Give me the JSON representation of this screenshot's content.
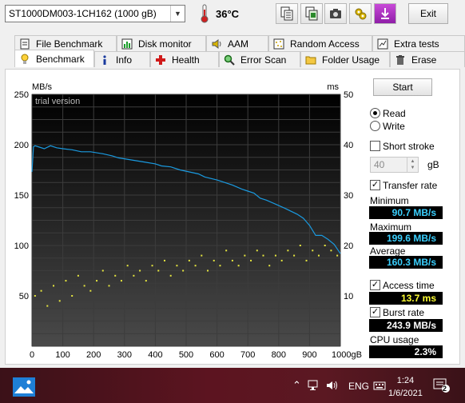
{
  "toolbar": {
    "drive": "ST1000DM003-1CH162 (1000 gB)",
    "temperature": "36°C",
    "exit_label": "Exit",
    "icons": [
      "copy-text-icon",
      "copy-screenshot-icon",
      "camera-icon",
      "options-icon",
      "download-icon"
    ]
  },
  "tabs_top": [
    {
      "label": "File Benchmark",
      "icon": "file-icon"
    },
    {
      "label": "Disk monitor",
      "icon": "monitor-icon"
    },
    {
      "label": "AAM",
      "icon": "speaker-icon"
    },
    {
      "label": "Random Access",
      "icon": "random-icon"
    },
    {
      "label": "Extra tests",
      "icon": "extra-icon"
    }
  ],
  "tabs_bottom": [
    {
      "label": "Benchmark",
      "icon": "lightbulb-icon",
      "active": true
    },
    {
      "label": "Info",
      "icon": "info-icon"
    },
    {
      "label": "Health",
      "icon": "health-cross-icon"
    },
    {
      "label": "Error Scan",
      "icon": "magnifier-icon"
    },
    {
      "label": "Folder Usage",
      "icon": "folder-icon"
    },
    {
      "label": "Erase",
      "icon": "trash-icon"
    }
  ],
  "chart_data": {
    "type": "line",
    "annotation": "trial version",
    "y_left_unit": "MB/s",
    "y_right_unit": "ms",
    "x_unit": "gB",
    "x_ticks": [
      0,
      100,
      200,
      300,
      400,
      500,
      600,
      700,
      800,
      900,
      1000
    ],
    "y_left_ticks": [
      50,
      100,
      150,
      200,
      250
    ],
    "y_right_ticks": [
      10,
      20,
      30,
      40,
      50
    ],
    "xlim": [
      0,
      1000
    ],
    "ylim_left": [
      0,
      250
    ],
    "ylim_right": [
      0,
      50
    ],
    "grid": true,
    "series": [
      {
        "name": "Transfer rate",
        "color": "#1a9ae0",
        "axis": "left",
        "x": [
          0,
          5,
          10,
          20,
          40,
          60,
          80,
          100,
          130,
          160,
          190,
          230,
          260,
          280,
          300,
          320,
          360,
          400,
          420,
          450,
          480,
          510,
          540,
          560,
          600,
          620,
          650,
          680,
          700,
          720,
          740,
          760,
          790,
          820,
          840,
          860,
          880,
          900,
          920,
          940,
          960,
          980,
          1000
        ],
        "y": [
          173,
          198,
          199,
          198,
          196,
          199,
          197,
          196,
          195,
          193,
          193,
          191,
          189,
          187,
          186,
          185,
          183,
          181,
          179,
          178,
          175,
          173,
          171,
          168,
          165,
          163,
          160,
          156,
          154,
          152,
          147,
          145,
          141,
          137,
          134,
          131,
          127,
          120,
          110,
          110,
          106,
          101,
          92
        ]
      },
      {
        "name": "Access time",
        "color": "#e6e640",
        "axis": "right",
        "type": "scatter",
        "x": [
          10,
          30,
          50,
          70,
          90,
          110,
          130,
          150,
          170,
          190,
          210,
          230,
          250,
          270,
          290,
          310,
          330,
          350,
          370,
          390,
          410,
          430,
          450,
          470,
          490,
          510,
          530,
          550,
          570,
          590,
          610,
          630,
          650,
          670,
          690,
          710,
          730,
          750,
          770,
          790,
          810,
          830,
          850,
          870,
          890,
          910,
          930,
          950,
          970,
          990
        ],
        "y": [
          10,
          11,
          8,
          12,
          9,
          13,
          10,
          14,
          12,
          11,
          13,
          15,
          12,
          14,
          13,
          16,
          14,
          15,
          13,
          16,
          15,
          17,
          14,
          16,
          15,
          17,
          16,
          18,
          15,
          17,
          16,
          19,
          17,
          16,
          18,
          17,
          19,
          18,
          16,
          18,
          17,
          19,
          18,
          20,
          17,
          19,
          18,
          20,
          19,
          18
        ]
      }
    ]
  },
  "side": {
    "start_label": "Start",
    "read_label": "Read",
    "write_label": "Write",
    "short_stroke_label": "Short stroke",
    "stroke_value": "40",
    "stroke_unit": "gB",
    "transfer_rate_label": "Transfer rate",
    "minimum_label": "Minimum",
    "minimum_value": "90.7 MB/s",
    "maximum_label": "Maximum",
    "maximum_value": "199.6 MB/s",
    "average_label": "Average",
    "average_value": "160.3 MB/s",
    "access_time_label": "Access time",
    "access_time_value": "13.7 ms",
    "burst_rate_label": "Burst rate",
    "burst_rate_value": "243.9 MB/s",
    "cpu_usage_label": "CPU usage",
    "cpu_usage_value": "2.3%"
  },
  "taskbar": {
    "language": "ENG",
    "time": "1:24",
    "date": "1/6/2021",
    "notification_count": "2"
  }
}
